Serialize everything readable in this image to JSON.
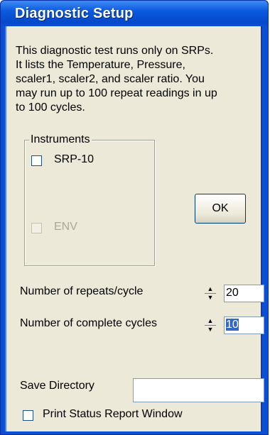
{
  "window": {
    "title": "Diagnostic Setup"
  },
  "description": "This diagnostic test runs only on SRPs.\nIt lists the Temperature, Pressure,\nscaler1, scaler2, and scaler ratio.  You\nmay run up to 100 repeat readings in up\nto 100 cycles.",
  "instruments": {
    "legend": "Instruments",
    "items": [
      {
        "label": "SRP-10",
        "checked": false,
        "enabled": true
      },
      {
        "label": "ENV",
        "checked": false,
        "enabled": false
      }
    ]
  },
  "ok_button": {
    "label": "OK"
  },
  "repeats": {
    "label": "Number of repeats/cycle",
    "value": "20"
  },
  "cycles": {
    "label": "Number of complete cycles",
    "value": "10"
  },
  "save_directory": {
    "label": "Save Directory",
    "value": ""
  },
  "print_status": {
    "label": "Print Status Report Window",
    "checked": false
  }
}
